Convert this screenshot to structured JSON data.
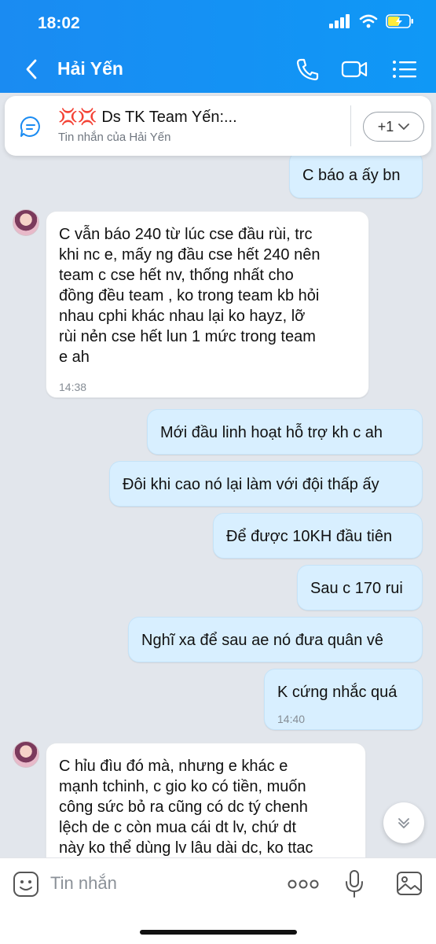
{
  "status_bar": {
    "time": "18:02"
  },
  "header": {
    "contact_name": "Hải Yến"
  },
  "pinned": {
    "title": "💢💢 Ds TK Team Yến:...",
    "subtitle": "Tin nhắn của Hải Yến",
    "more_label": "+1"
  },
  "messages": [
    {
      "side": "out",
      "text": "C báo a ấy bn"
    },
    {
      "side": "in",
      "text": "C vẫn báo 240 từ lúc cse đầu rùi, trc\nkhi nc e, mấy ng đầu cse hết 240 nên\nteam c cse hết nv, thống nhất cho\nđồng đều team , ko trong team kb hỏi\nnhau cphi khác nhau lại ko hayz, lỡ\nrùi nẻn cse hết lun 1 mức trong team\ne ah",
      "time": "14:38"
    },
    {
      "side": "out",
      "text": "Mới đầu linh hoạt hỗ trợ kh c ah"
    },
    {
      "side": "out",
      "text": "Đôi khi cao nó lại làm với đội thấp ấy"
    },
    {
      "side": "out",
      "text": "Để được 10KH đầu tiên"
    },
    {
      "side": "out",
      "text": "Sau c 170 rui"
    },
    {
      "side": "out",
      "text": "Nghĩ xa để sau ae nó đưa quân vê"
    },
    {
      "side": "out",
      "text": "K cứng nhắc quá",
      "time": "14:40"
    },
    {
      "side": "in",
      "text": "C hỉu đìu đó mà, nhưng e khác e\nmạnh tchinh, c gio ko có tiền, muốn\ncông sức bỏ ra cũng có dc tý chenh\nlệch de c còn mua cái dt lv, chứ dt\nnày ko thể dùng lv lâu dài dc, ko ttac"
    }
  ],
  "input": {
    "placeholder": "Tin nhắn"
  },
  "colors": {
    "header": "#1a8bf2",
    "outgoing_bubble": "#d8efff",
    "incoming_bubble": "#ffffff",
    "background": "#e2e6ec"
  },
  "icons": [
    "back-icon",
    "phone-icon",
    "video-icon",
    "menu-icon",
    "chat-icon",
    "chevron-down-icon",
    "sticker-icon",
    "more-icon",
    "microphone-icon",
    "image-icon"
  ]
}
